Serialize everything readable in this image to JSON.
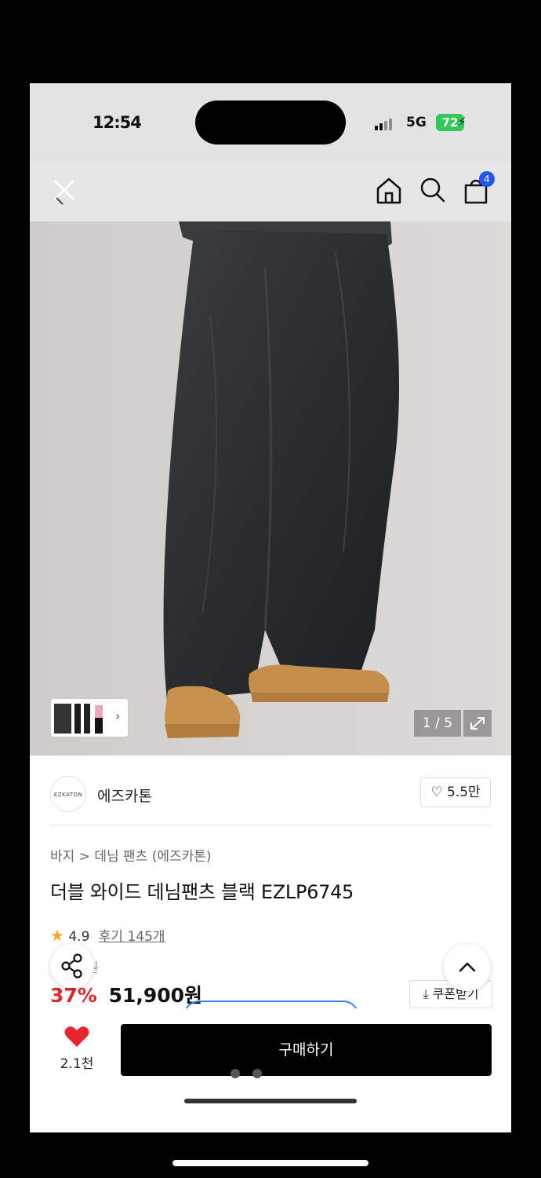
{
  "status": {
    "time": "12:54",
    "network": "5G",
    "battery": "72"
  },
  "header": {
    "cart_count": "4"
  },
  "gallery": {
    "counter": "1 / 5"
  },
  "brand": {
    "logo_text": "EZKATON",
    "name": "에즈카톤",
    "likes": "5.5만"
  },
  "product": {
    "breadcrumb": "바지 > 데님 팬츠 (에즈카톤)",
    "title": "더블 와이드 데님팬츠 블랙 EZLP6745",
    "rating": "4.9",
    "review_link": "후기 145개",
    "original_price": "원",
    "discount": "37%",
    "price": "51,900원",
    "coupon_label": "쿠폰받기"
  },
  "bottom": {
    "fav_count": "2.1천",
    "buy_label": "구매하기"
  },
  "colors": {
    "discount": "#e0282a",
    "heart": "#e8242c",
    "badge": "#2255e8",
    "battery": "#34c759"
  }
}
